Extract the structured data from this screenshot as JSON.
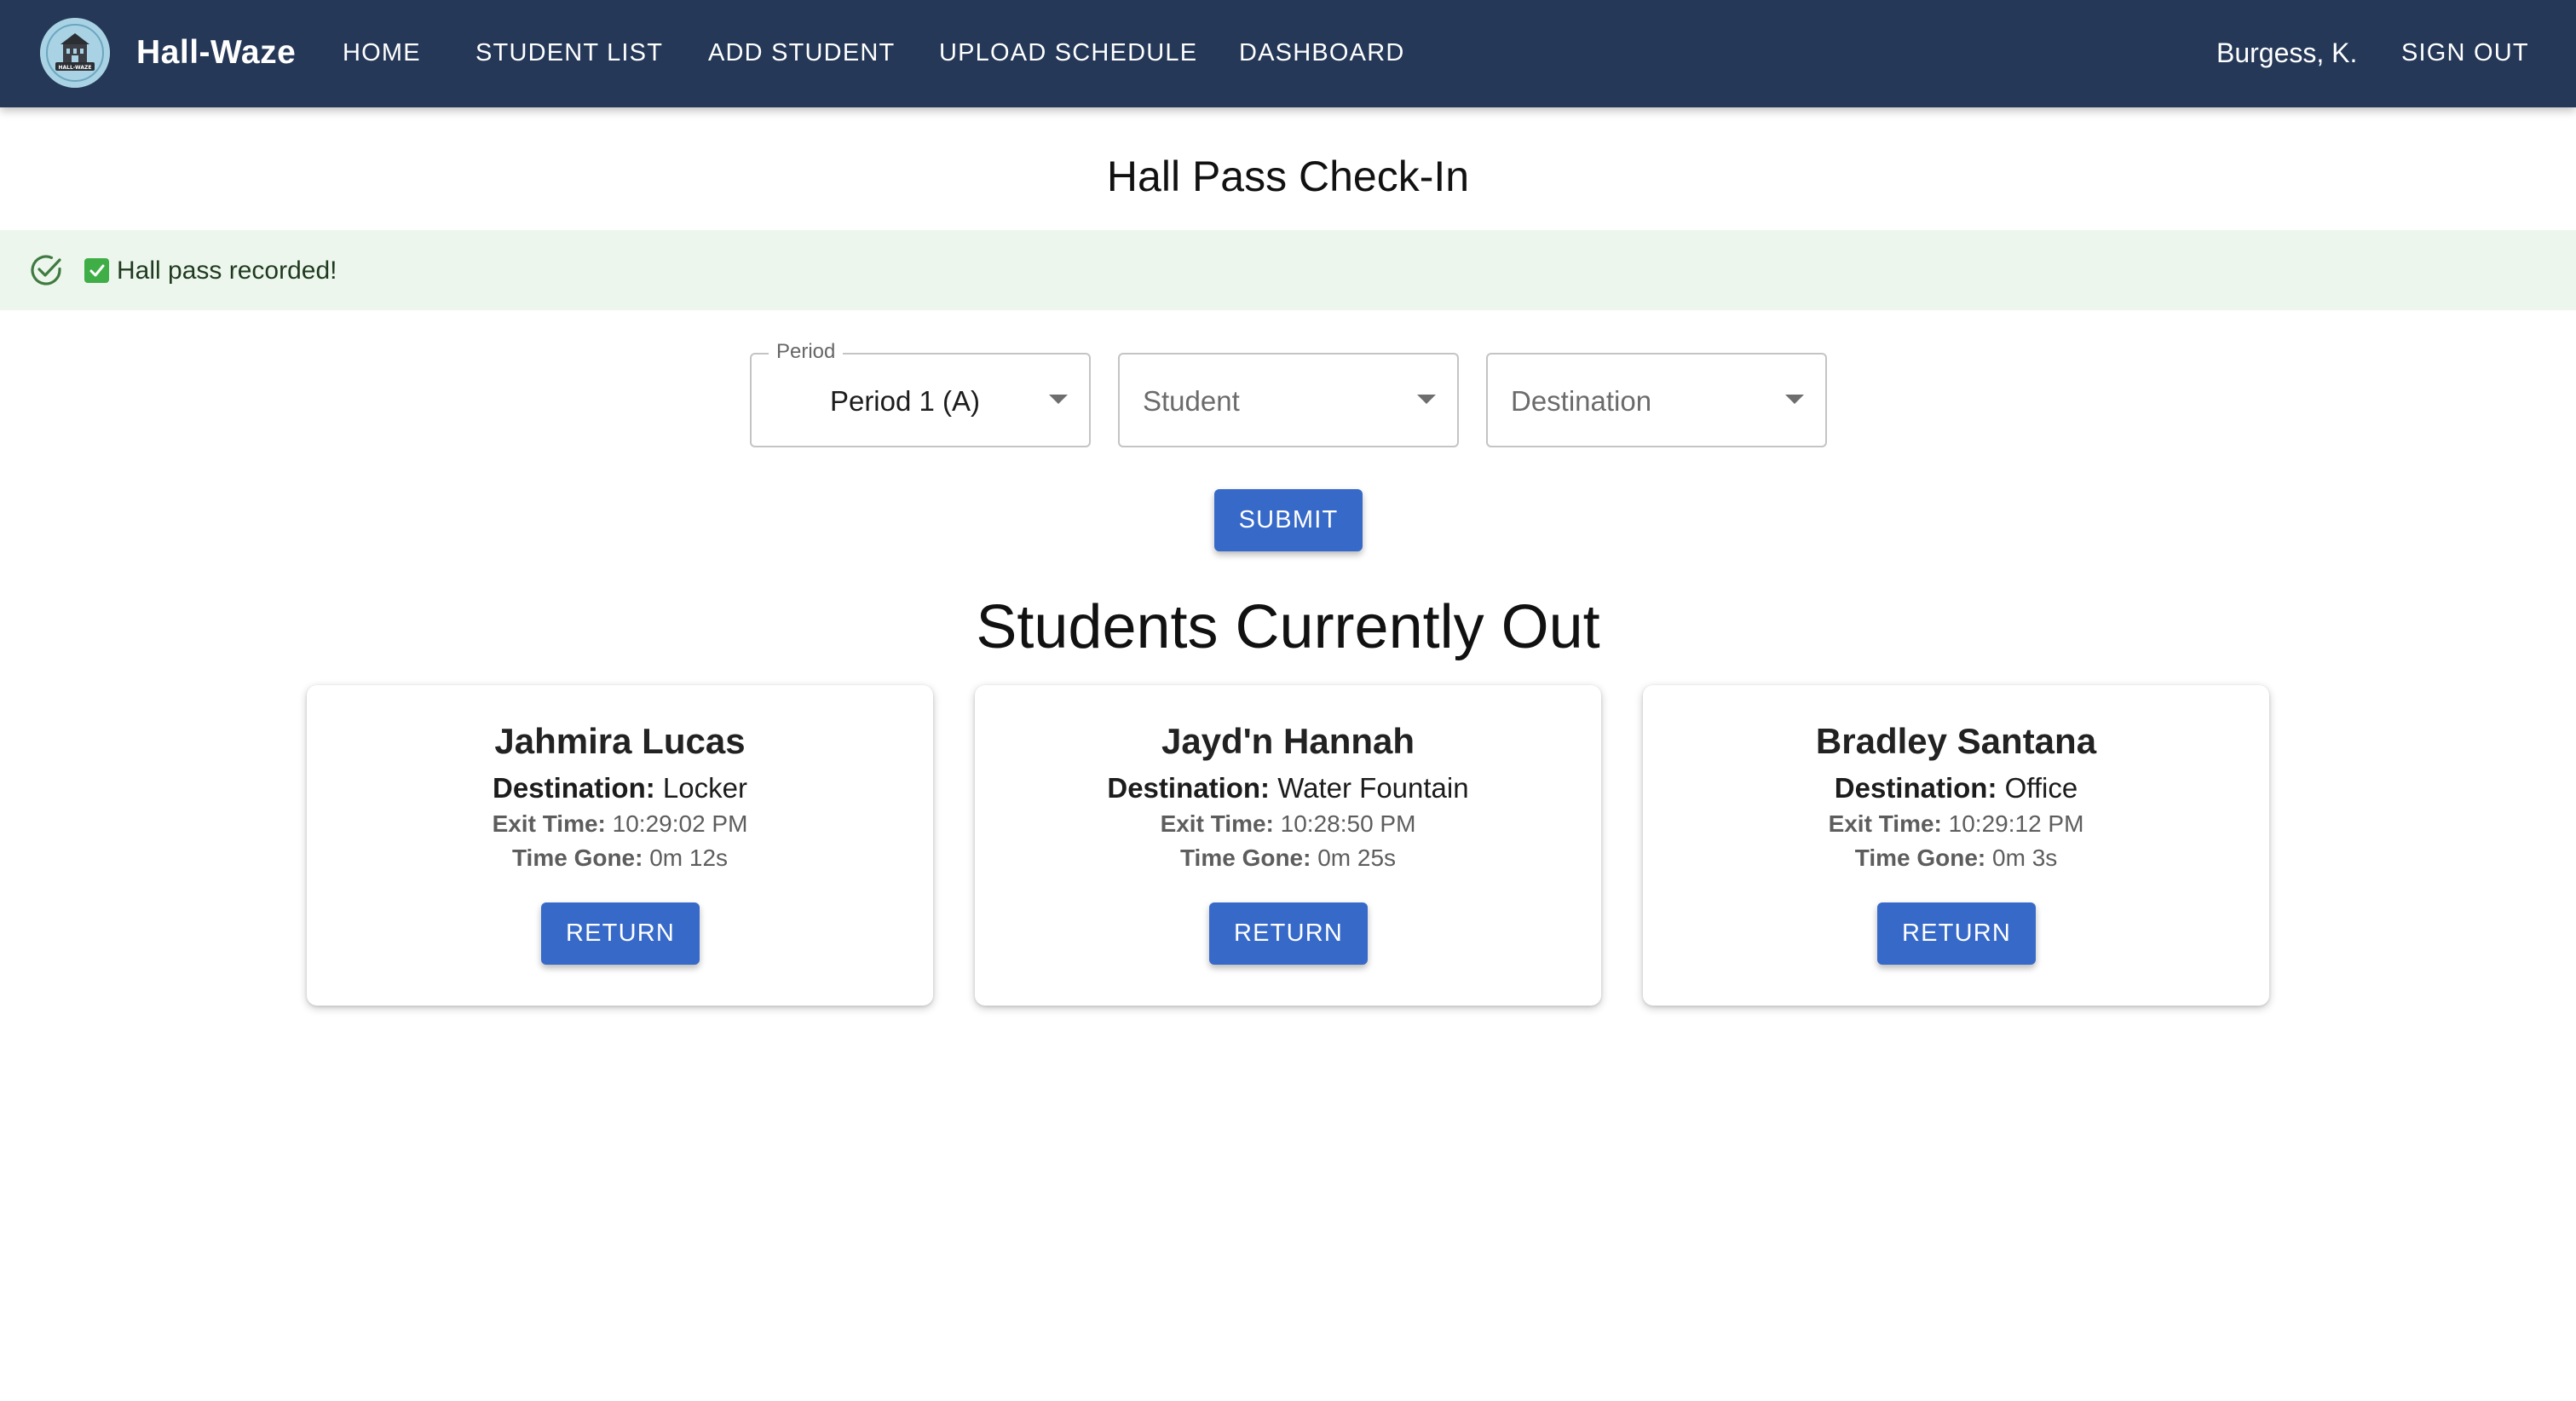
{
  "app": {
    "brand": "Hall-Waze",
    "logo_text": "HALL-WAZE"
  },
  "nav": {
    "items": [
      {
        "label": "HOME"
      },
      {
        "label": "STUDENT LIST"
      },
      {
        "label": "ADD STUDENT"
      },
      {
        "label": "UPLOAD SCHEDULE"
      },
      {
        "label": "DASHBOARD"
      }
    ],
    "user": "Burgess, K.",
    "sign_out": "SIGN OUT"
  },
  "page": {
    "title": "Hall Pass Check-In"
  },
  "alert": {
    "message": "Hall pass recorded!",
    "icon": "check-circle-outline-icon",
    "emoji_icon": "green-check-box-icon",
    "severity_color": "#2e7d32"
  },
  "form": {
    "period": {
      "label": "Period",
      "value": "Period 1 (A)"
    },
    "student": {
      "placeholder": "Student"
    },
    "destination": {
      "placeholder": "Destination"
    },
    "submit_label": "SUBMIT"
  },
  "students_out": {
    "title": "Students Currently Out",
    "destination_label": "Destination:",
    "exit_time_label": "Exit Time:",
    "time_gone_label": "Time Gone:",
    "return_label": "RETURN",
    "cards": [
      {
        "name": "Jahmira Lucas",
        "destination": "Locker",
        "exit_time": "10:29:02 PM",
        "time_gone": "0m 12s"
      },
      {
        "name": "Jayd'n Hannah",
        "destination": "Water Fountain",
        "exit_time": "10:28:50 PM",
        "time_gone": "0m 25s"
      },
      {
        "name": "Bradley Santana",
        "destination": "Office",
        "exit_time": "10:29:12 PM",
        "time_gone": "0m 3s"
      }
    ]
  },
  "colors": {
    "appbar": "#253858",
    "primary": "#3669c8",
    "alert_bg": "#edf6ec"
  }
}
